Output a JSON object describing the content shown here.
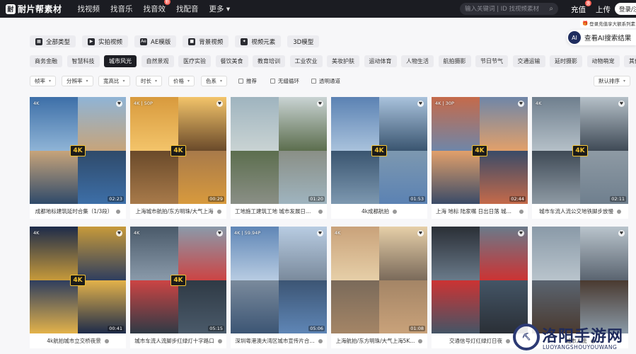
{
  "header": {
    "logo_text": "耐片帮素材",
    "nav": [
      "找视频",
      "找音乐",
      "找音效",
      "找配音",
      "更多"
    ],
    "hot_badge": "新",
    "search_placeholder": "输入关键词 | ID 找视频素材",
    "recharge_label": "充值",
    "upload_label": "上传",
    "login_label": "登录/注册"
  },
  "promo_text": "登录充值享大额系列素",
  "ai_search_label": "查看AI搜索结果",
  "types": [
    {
      "icon": "grid-icon",
      "label": "全部类型"
    },
    {
      "icon": "video-icon",
      "label": "实拍视频"
    },
    {
      "icon": "ae-icon",
      "label": "AE模版"
    },
    {
      "icon": "bg-video-icon",
      "label": "背景视频"
    },
    {
      "icon": "element-icon",
      "label": "视频元素"
    },
    {
      "icon": "",
      "label": "3D模型"
    }
  ],
  "categories": [
    "商务金融",
    "智慧科技",
    "城市风光",
    "自然景观",
    "医疗实验",
    "餐饮美食",
    "教育培训",
    "工业农业",
    "美妆护肤",
    "运动体育",
    "人物生活",
    "航拍摄影",
    "节日节气",
    "交通运输",
    "延时摄影",
    "动物萌宠",
    "其他"
  ],
  "active_category": "城市风光",
  "filters": [
    {
      "label": "帧率"
    },
    {
      "label": "分辨率"
    },
    {
      "label": "宽高比"
    },
    {
      "label": "时长"
    },
    {
      "label": "价格"
    },
    {
      "label": "色系"
    }
  ],
  "checkboxes": [
    "推荐",
    "无缝循环",
    "透明通道"
  ],
  "sort_label": "默认排序",
  "cards": [
    {
      "res": "4K",
      "dur": "02:23",
      "title": "成都地标建筑延时合集（1/3段）",
      "show4k": true
    },
    {
      "res": "4K | 50P",
      "dur": "00:29",
      "title": "上海城市航拍/东方明珠/大气上海",
      "show4k": true
    },
    {
      "res": "",
      "dur": "01:20",
      "title": "工地施工建筑工地 城市发展日落...",
      "show4k": false
    },
    {
      "res": "",
      "dur": "01:53",
      "title": "4k成都航拍",
      "show4k": true
    },
    {
      "res": "4K | 30P",
      "dur": "02:44",
      "title": "上海 地标 陆家嘴 日出日落 城市...",
      "show4k": true
    },
    {
      "res": "4K",
      "dur": "02:11",
      "title": "城市车流人流公交地铁脚步放慢",
      "show4k": true
    },
    {
      "res": "4K",
      "dur": "00:41",
      "title": "4k航拍城市立交桥夜景",
      "show4k": true
    },
    {
      "res": "4K",
      "dur": "05:15",
      "title": "城市车流人流脚步红绿灯十字路口",
      "show4k": true
    },
    {
      "res": "4K | 59.94P",
      "dur": "05:06",
      "title": "深圳粤港澳大湾区城市宣传片合...",
      "show4k": false
    },
    {
      "res": "4K",
      "dur": "01:08",
      "title": "上海航拍/东方明珠/大气上海5K...",
      "show4k": false
    },
    {
      "res": "",
      "dur": "",
      "title": "交通信号灯红绿灯日夜",
      "show4k": false
    },
    {
      "res": "",
      "dur": "",
      "title": "城市人流",
      "show4k": false
    }
  ],
  "watermark": {
    "title": "洛阳手游网",
    "sub": "LUOYANGSHOUYOUWANG"
  },
  "colors": {
    "topbar": "#1b1c22",
    "active_cat": "#1d1e24",
    "badge": "#f2c230"
  }
}
